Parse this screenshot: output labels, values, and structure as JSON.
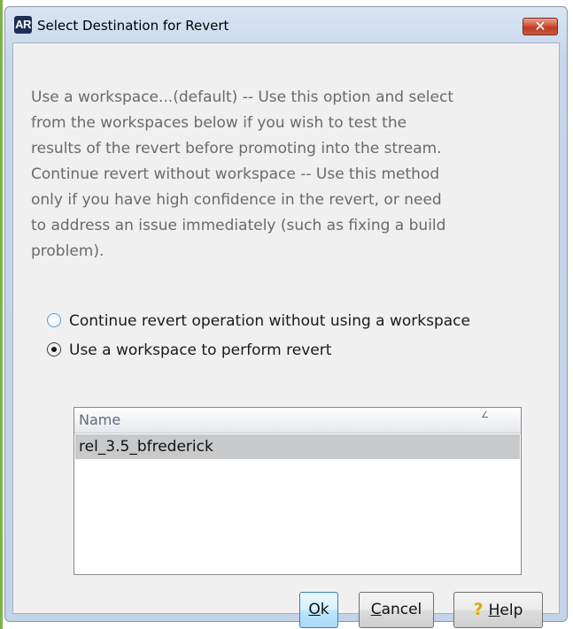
{
  "window": {
    "app_icon": "AR",
    "title": "Select Destination for Revert",
    "close_label": "✕"
  },
  "description": {
    "lines": [
      "Use a workspace...(default) -- Use this option and select",
      "from the workspaces below if you wish to test the",
      "results of the revert before promoting into the stream.",
      "Continue revert without workspace -- Use this method",
      "only if you have high confidence in the revert, or need",
      "to address an issue immediately (such as fixing a build",
      "problem)."
    ]
  },
  "options": {
    "without_workspace": {
      "label": "Continue revert operation without using a workspace",
      "checked": false
    },
    "use_workspace": {
      "label": "Use a workspace to perform revert",
      "checked": true
    }
  },
  "workspace_list": {
    "column_header": "Name",
    "sort_glyph": "∠",
    "rows": [
      "rel_3.5_bfrederick"
    ],
    "selected_index": 0
  },
  "buttons": {
    "ok": {
      "mnemonic": "O",
      "rest": "k"
    },
    "cancel": {
      "mnemonic": "C",
      "rest": "ancel"
    },
    "help": {
      "icon": "?",
      "mnemonic": "H",
      "rest": "elp"
    }
  },
  "colors": {
    "title_gradient_top": "#d8e5f3",
    "client_bg": "#f0f0f0",
    "selected_row": "#c8c9cb",
    "close_button": "#c94a30"
  }
}
